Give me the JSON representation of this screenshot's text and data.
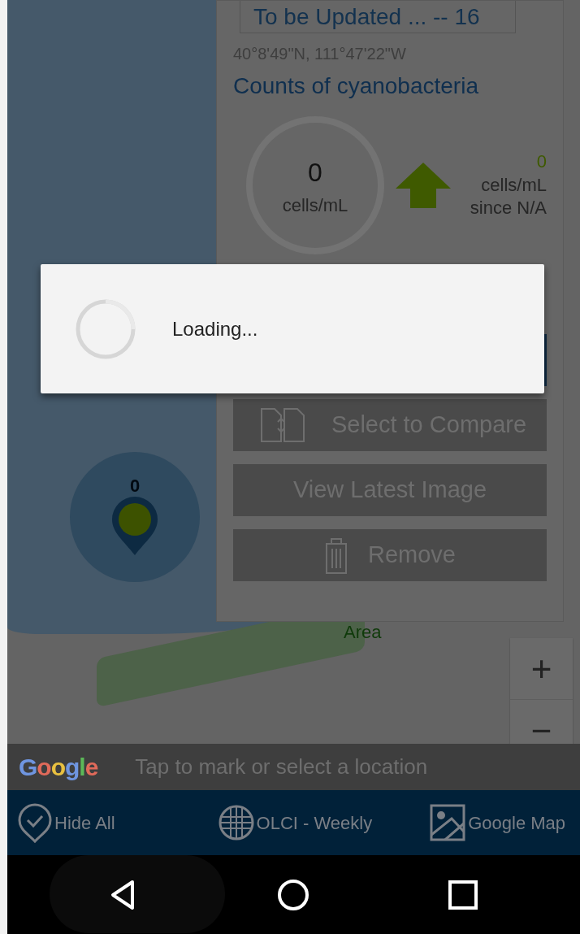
{
  "location_panel": {
    "name_field": {
      "value": "To be Updated ... -- 16"
    },
    "coordinates": "40°8'49\"N, 111°47'22\"W",
    "title": "Counts of cyanobacteria",
    "gauge": {
      "value": "0",
      "unit": "cells/mL"
    },
    "change": {
      "value": "0",
      "unit": "cells/mL",
      "since": "since N/A"
    },
    "buttons": [
      {
        "kind": "compare",
        "label": "Select to Compare"
      },
      {
        "kind": "plain",
        "label": "View Latest Image"
      },
      {
        "kind": "remove",
        "label": "Remove"
      }
    ]
  },
  "map": {
    "marker": {
      "count": "0"
    },
    "area_label": "Area",
    "zoom_buttons": [
      "+",
      "−"
    ],
    "attribution": "Google"
  },
  "hint": "Tap to mark or select a location",
  "bottom_nav": [
    {
      "kind": "pin-check",
      "label": "Hide All"
    },
    {
      "kind": "globe",
      "label": "OLCI - Weekly"
    },
    {
      "kind": "map",
      "label": "Google Map"
    }
  ],
  "dialog": {
    "message": "Loading..."
  }
}
